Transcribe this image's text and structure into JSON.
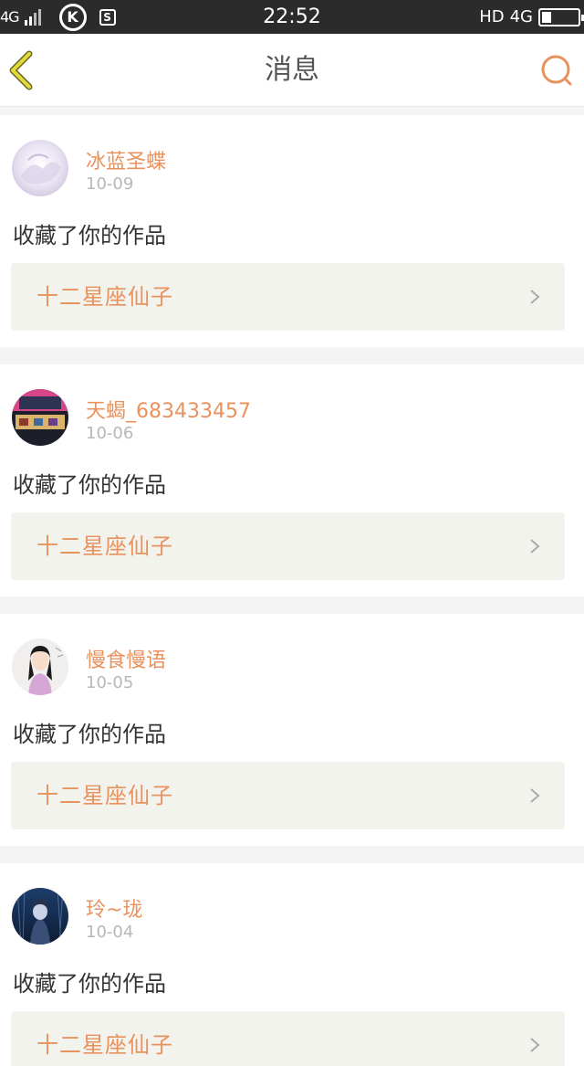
{
  "status_bar": {
    "network": "4G",
    "time": "22:52",
    "right_text": "HD",
    "right_network": "4G",
    "k_badge": "K",
    "s_badge": "S"
  },
  "header": {
    "title": "消息",
    "back_icon": "chevron-left-icon",
    "search_icon": "search-icon"
  },
  "colors": {
    "accent": "#e8925e",
    "back_icon": "#e5d93a",
    "card_bg": "#f3f3ee",
    "page_bg": "#f4f4f4"
  },
  "messages": [
    {
      "username": "冰蓝圣蝶",
      "date": "10-09",
      "action": "收藏了你的作品",
      "work_title": "十二星座仙子"
    },
    {
      "username": "天蝎_683433457",
      "date": "10-06",
      "action": "收藏了你的作品",
      "work_title": "十二星座仙子"
    },
    {
      "username": "慢食慢语",
      "date": "10-05",
      "action": "收藏了你的作品",
      "work_title": "十二星座仙子"
    },
    {
      "username": "玲~珑",
      "date": "10-04",
      "action": "收藏了你的作品",
      "work_title": "十二星座仙子"
    }
  ]
}
